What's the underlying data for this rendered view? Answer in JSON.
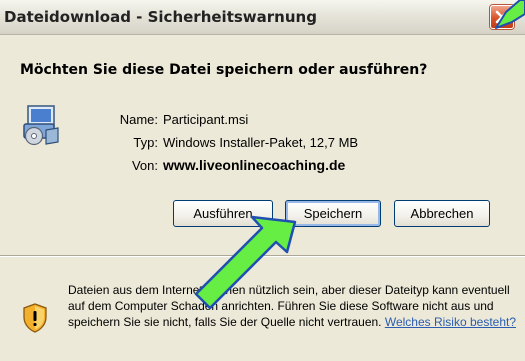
{
  "dialog": {
    "title": "Dateidownload - Sicherheitswarnung",
    "heading": "Möchten Sie diese Datei speichern oder ausführen?",
    "close_icon": "close-x-icon"
  },
  "file_info": {
    "name_label": "Name:",
    "name_value": "Participant.msi",
    "type_label": "Typ:",
    "type_value": "Windows Installer-Paket, 12,7 MB",
    "from_label": "Von:",
    "from_value": "www.liveonlinecoaching.de",
    "icon": "installer-package-icon"
  },
  "buttons": {
    "run": "Ausführen",
    "save": "Speichern",
    "cancel": "Abbrechen"
  },
  "warning": {
    "text": "Dateien aus dem Internet können nützlich sein, aber dieser Dateityp kann eventuell auf dem Computer Schaden anrichten. Führen Sie diese Software nicht aus und speichern Sie sie nicht, falls Sie der Quelle nicht vertrauen. ",
    "link": "Welches Risiko besteht?",
    "icon": "security-shield-icon"
  },
  "colors": {
    "dialog_background": "#ece9d8",
    "link": "#2a5db0",
    "close_button": "#d9532a",
    "arrow_fill": "#66ee44",
    "arrow_outline": "#1f4fb0"
  }
}
